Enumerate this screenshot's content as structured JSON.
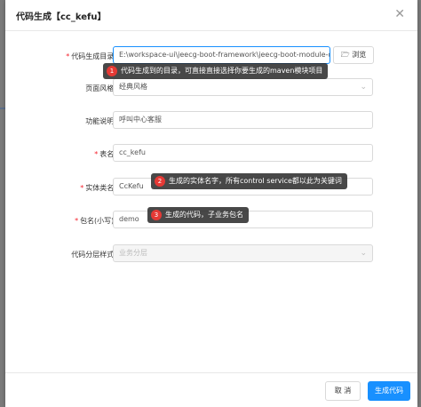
{
  "modal": {
    "title": "代码生成【cc_kefu】",
    "close_icon": "close-icon"
  },
  "form": {
    "output_dir": {
      "label": "代码生成目录:",
      "required": true,
      "value": "E:\\workspace-ui\\jeecg-boot-framework\\jeecg-boot-module-den",
      "browse_label": "浏览",
      "browse_icon": "folder-open-icon"
    },
    "page_style": {
      "label": "页面风格:",
      "required": false,
      "value": "经典风格"
    },
    "func_desc": {
      "label": "功能说明:",
      "required": false,
      "value": "呼叫中心客服"
    },
    "table_name": {
      "label": "表名:",
      "required": true,
      "value": "cc_kefu"
    },
    "entity_name": {
      "label": "实体类名:",
      "required": true,
      "value": "CcKefu"
    },
    "package_name": {
      "label": "包名(小写):",
      "required": true,
      "value": "demo"
    },
    "layer_style": {
      "label": "代码分层样式:",
      "required": false,
      "placeholder": "业务分层"
    }
  },
  "annotations": [
    {
      "num": "1",
      "text": "代码生成到的目录，可直接直接选择你要生成的maven模块项目"
    },
    {
      "num": "2",
      "text": "生成的实体名字，所有control service都以此为关键词"
    },
    {
      "num": "3",
      "text": "生成的代码，子业务包名"
    }
  ],
  "footer": {
    "cancel_label": "取 消",
    "generate_label": "生成代码"
  },
  "colors": {
    "primary": "#1890ff",
    "required": "#f5222d",
    "annotation_badge": "#e53935"
  }
}
